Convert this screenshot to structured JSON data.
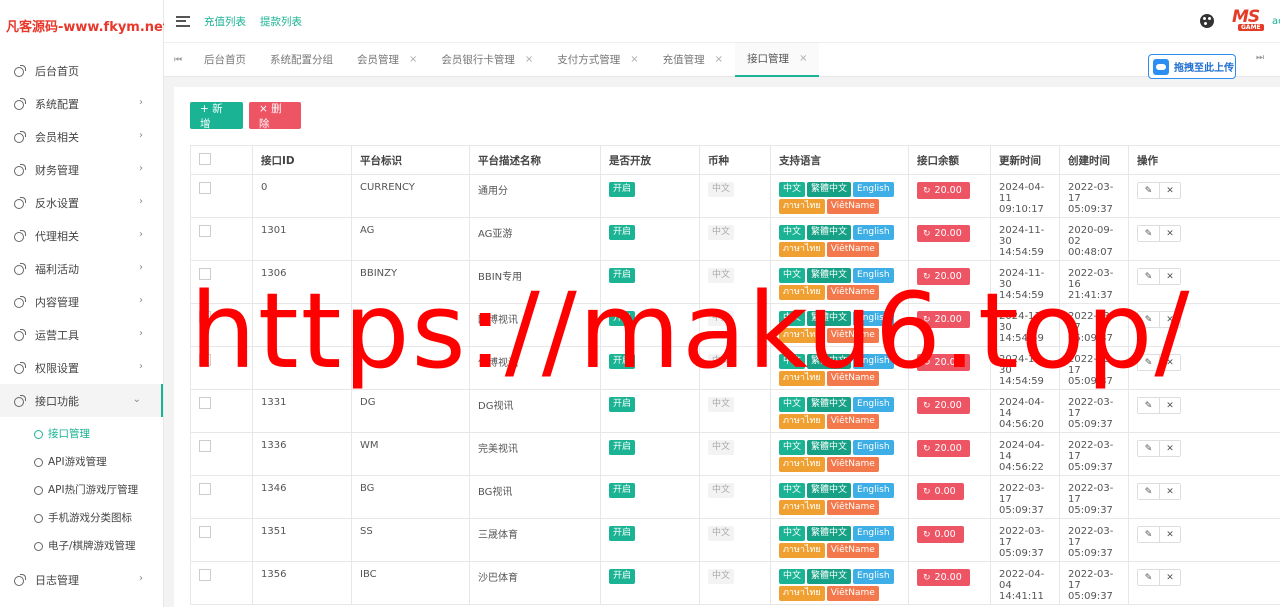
{
  "brand": {
    "text": "凡客源码-www.fkym.net"
  },
  "header": {
    "links": [
      "充值列表",
      "提款列表"
    ],
    "logo_ms": "MS",
    "logo_game": "GAME",
    "user": "ac"
  },
  "sidebar": {
    "items": [
      {
        "label": "后台首页",
        "arrow": false
      },
      {
        "label": "系统配置",
        "arrow": true
      },
      {
        "label": "会员相关",
        "arrow": true
      },
      {
        "label": "财务管理",
        "arrow": true
      },
      {
        "label": "反水设置",
        "arrow": true
      },
      {
        "label": "代理相关",
        "arrow": true
      },
      {
        "label": "福利活动",
        "arrow": true
      },
      {
        "label": "内容管理",
        "arrow": true
      },
      {
        "label": "运营工具",
        "arrow": true
      },
      {
        "label": "权限设置",
        "arrow": true
      },
      {
        "label": "接口功能",
        "arrow": true,
        "active": true
      }
    ],
    "subitems": [
      "接口管理",
      "API游戏管理",
      "API热门游戏厅管理",
      "手机游戏分类图标",
      "电子/棋牌游戏管理"
    ],
    "last_item": "日志管理"
  },
  "tabs": [
    {
      "label": "后台首页",
      "close": false
    },
    {
      "label": "系统配置分组",
      "close": false
    },
    {
      "label": "会员管理",
      "close": true
    },
    {
      "label": "会员银行卡管理",
      "close": true
    },
    {
      "label": "支付方式管理",
      "close": true
    },
    {
      "label": "充值管理",
      "close": true
    },
    {
      "label": "接口管理",
      "close": true,
      "active": true
    }
  ],
  "upload_label": "拖拽至此上传",
  "toolbar": {
    "add_label": "+ 新增",
    "delete_label": "× 删除"
  },
  "table": {
    "headers": [
      "接口ID",
      "平台标识",
      "平台描述名称",
      "是否开放",
      "币种",
      "支持语言",
      "接口余额",
      "更新时间",
      "创建时间",
      "操作"
    ],
    "open_label": "开启",
    "currency_label": "中文",
    "languages": [
      "中文",
      "繁體中文",
      "English",
      "ภาษาไทย",
      "ViêtName"
    ],
    "rows": [
      {
        "id": "0",
        "code": "CURRENCY",
        "name": "通用分",
        "balance": "20.00",
        "updated": [
          "2024-04-11",
          "09:10:17"
        ],
        "created": [
          "2022-03-17",
          "05:09:37"
        ]
      },
      {
        "id": "1301",
        "code": "AG",
        "name": "AG亚游",
        "balance": "20.00",
        "updated": [
          "2024-11-30",
          "14:54:59"
        ],
        "created": [
          "2020-09-02",
          "00:48:07"
        ]
      },
      {
        "id": "1306",
        "code": "BBINZY",
        "name": "BBIN专用",
        "balance": "20.00",
        "updated": [
          "2024-11-30",
          "14:54:59"
        ],
        "created": [
          "2022-03-16",
          "21:41:37"
        ]
      },
      {
        "id": "",
        "code": "",
        "name": "欧博视讯",
        "balance": "20.00",
        "updated": [
          "2024-11-30",
          "14:54:59"
        ],
        "created": [
          "2022-03-17",
          "05:09:37"
        ]
      },
      {
        "id": "",
        "code": "",
        "name": "亿博视讯",
        "balance": "20.00",
        "updated": [
          "2024-11-30",
          "14:54:59"
        ],
        "created": [
          "2022-03-17",
          "05:09:37"
        ]
      },
      {
        "id": "1331",
        "code": "DG",
        "name": "DG视讯",
        "balance": "20.00",
        "updated": [
          "2024-04-14",
          "04:56:20"
        ],
        "created": [
          "2022-03-17",
          "05:09:37"
        ]
      },
      {
        "id": "1336",
        "code": "WM",
        "name": "完美视讯",
        "balance": "20.00",
        "updated": [
          "2024-04-14",
          "04:56:22"
        ],
        "created": [
          "2022-03-17",
          "05:09:37"
        ]
      },
      {
        "id": "1346",
        "code": "BG",
        "name": "BG视讯",
        "balance": "0.00",
        "updated": [
          "2022-03-17",
          "05:09:37"
        ],
        "created": [
          "2022-03-17",
          "05:09:37"
        ]
      },
      {
        "id": "1351",
        "code": "SS",
        "name": "三晟体育",
        "balance": "0.00",
        "updated": [
          "2022-03-17",
          "05:09:37"
        ],
        "created": [
          "2022-03-17",
          "05:09:37"
        ]
      },
      {
        "id": "1356",
        "code": "IBC",
        "name": "沙巴体育",
        "balance": "20.00",
        "updated": [
          "2022-04-04",
          "14:41:11"
        ],
        "created": [
          "2022-03-17",
          "05:09:37"
        ]
      }
    ]
  },
  "watermark": "https://maku6.top/",
  "colors": {
    "accent": "#1ab394",
    "danger": "#ed5565",
    "info": "#3daee6",
    "warning": "#f0a030"
  }
}
